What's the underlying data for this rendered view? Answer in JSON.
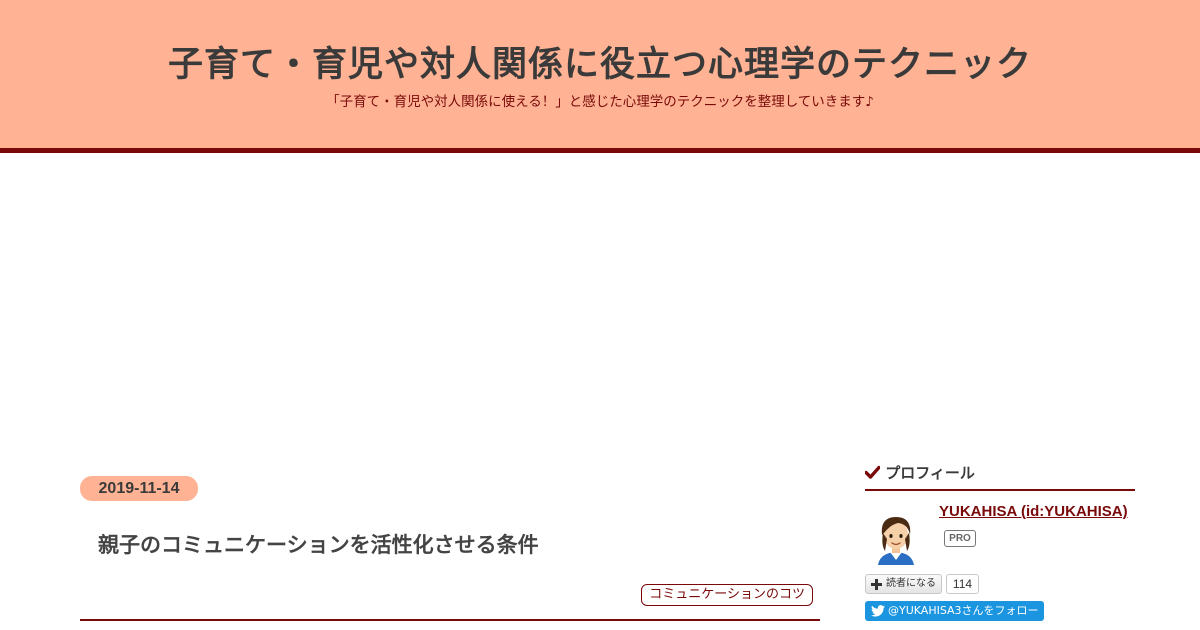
{
  "header": {
    "title": "子育て・育児や対人関係に役立つ心理学のテクニック",
    "description": "「子育て・育児や対人関係に使える！」と感じた心理学のテクニックを整理していきます♪"
  },
  "entry": {
    "date": "2019-11-14",
    "title": "親子のコミュニケーションを活性化させる条件",
    "category": "コミュニケーションのコツ"
  },
  "sidebar": {
    "profile": {
      "heading": "プロフィール",
      "heading_icon": "check-icon",
      "name": "YUKAHISA (id:YUKAHISA)",
      "badge": "PRO",
      "reader_button": "読者になる",
      "reader_count": "114",
      "twitter_follow": "@YUKAHISA3さんをフォロー"
    }
  },
  "colors": {
    "header_bg": "#ffb394",
    "accent": "#7a0a0a",
    "twitter": "#1b95e0"
  }
}
